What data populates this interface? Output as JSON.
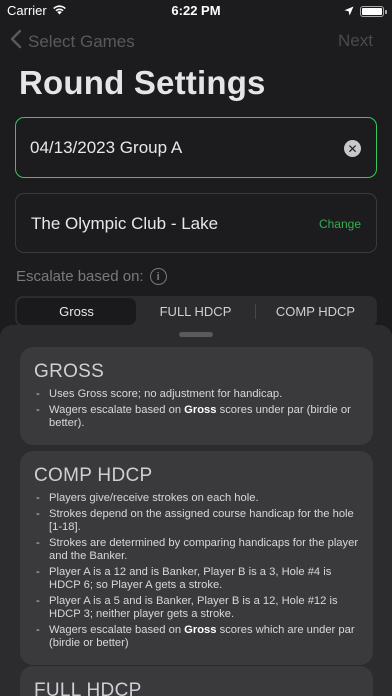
{
  "status": {
    "carrier": "Carrier",
    "time": "6:22 PM"
  },
  "nav": {
    "back_label": "Select Games",
    "next_label": "Next"
  },
  "title": "Round Settings",
  "round_name": {
    "value": "04/13/2023 Group A"
  },
  "course": {
    "name": "The Olympic Club - Lake",
    "change_label": "Change"
  },
  "escalate": {
    "label": "Escalate based on:",
    "info_glyph": "i"
  },
  "segments": [
    "Gross",
    "FULL HDCP",
    "COMP HDCP"
  ],
  "selected_segment": "Gross",
  "cards": {
    "gross": {
      "title": "GROSS",
      "items": [
        {
          "pre": "Uses Gross score; no adjustment for handicap.",
          "bold": "",
          "post": ""
        },
        {
          "pre": "Wagers escalate based on ",
          "bold": "Gross",
          "post": " scores under par (birdie or better)."
        }
      ]
    },
    "comp": {
      "title": "COMP HDCP",
      "items": [
        {
          "pre": "Players give/receive strokes on each hole.",
          "bold": "",
          "post": ""
        },
        {
          "pre": "Strokes depend on the assigned course handicap for the hole [1-18].",
          "bold": "",
          "post": ""
        },
        {
          "pre": "Strokes are determined by comparing handicaps for the player and the Banker.",
          "bold": "",
          "post": ""
        },
        {
          "pre": "Player A is a 12 and is Banker, Player B is a 3, Hole #4 is HDCP 6; so Player A gets a stroke.",
          "bold": "",
          "post": ""
        },
        {
          "pre": "Player A is a 5 and is Banker, Player B is a 12, Hole #12 is HDCP 3; neither player gets a stroke.",
          "bold": "",
          "post": ""
        },
        {
          "pre": "Wagers escalate based on ",
          "bold": "Gross",
          "post": " scores which are under par (birdie or better)"
        }
      ]
    },
    "full": {
      "title": "FULL HDCP"
    }
  }
}
